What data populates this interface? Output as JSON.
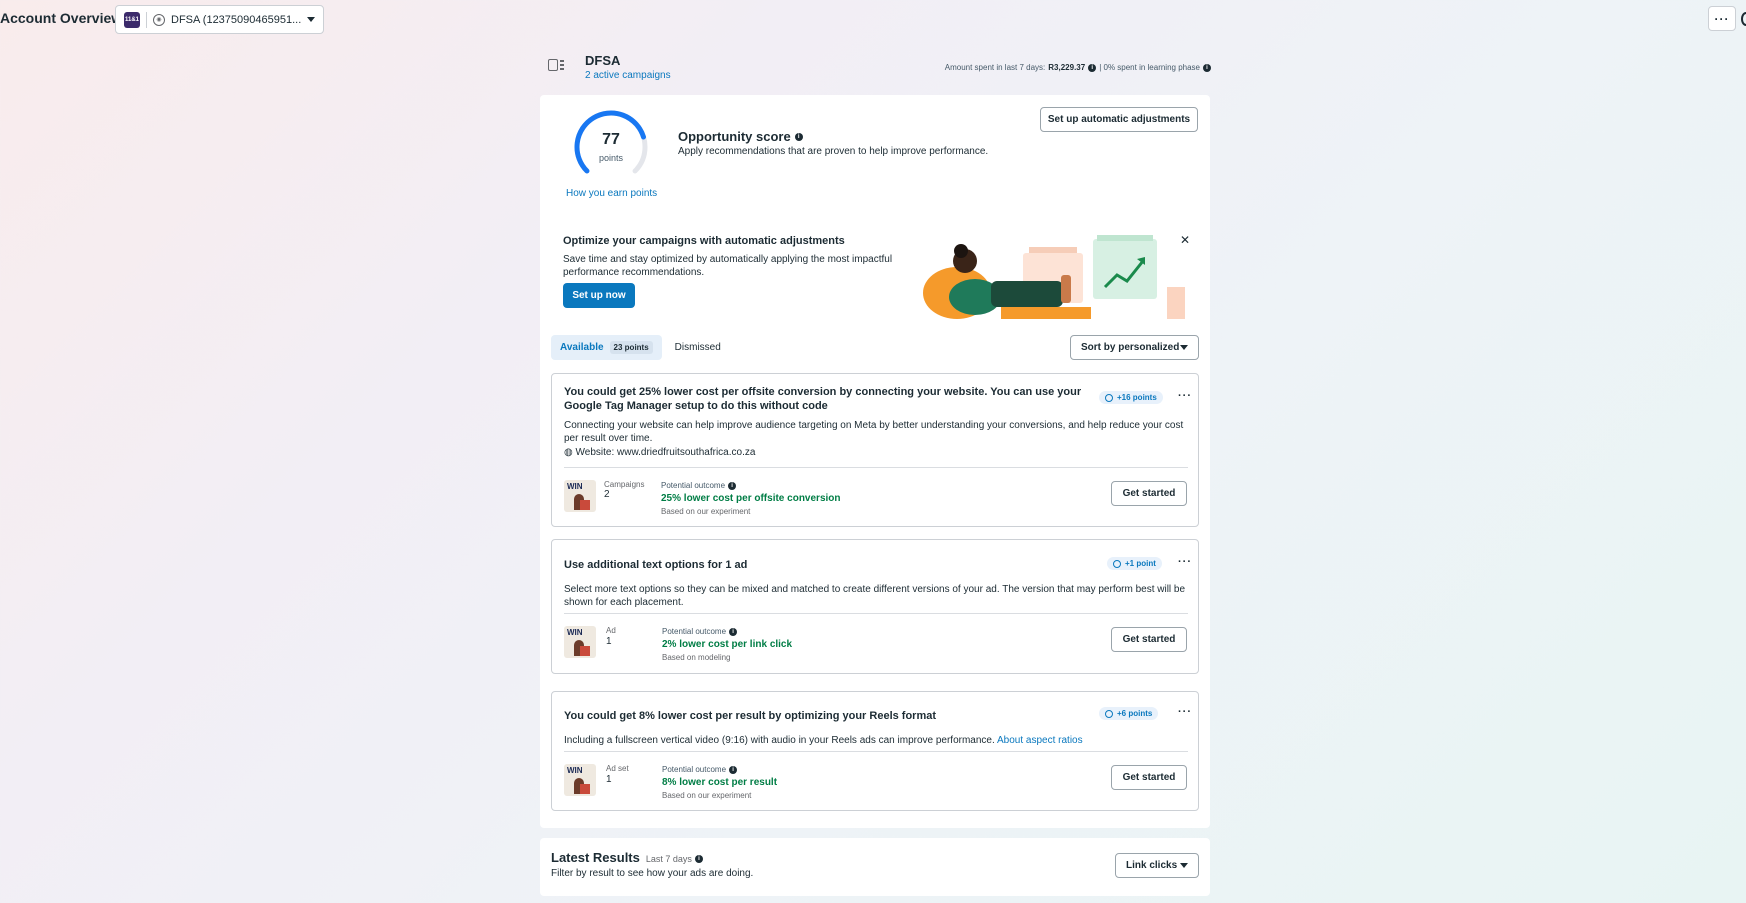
{
  "header": {
    "page_title": "Account Overview",
    "account_logo_text": "11&1",
    "account_label": "DFSA (12375090465951...",
    "more_label": "···"
  },
  "account": {
    "name": "DFSA",
    "campaigns_link": "2 active campaigns",
    "spend_prefix": "Amount spent in last 7 days:",
    "spend_value": "R3,229.37",
    "learning_text": "| 0% spent in learning phase"
  },
  "score": {
    "value": "77",
    "unit": "points",
    "fraction": 0.77,
    "earn_link": "How you earn points",
    "title": "Opportunity score",
    "description": "Apply recommendations that are proven to help improve performance.",
    "auto_button": "Set up automatic adjustments"
  },
  "banner": {
    "title": "Optimize your campaigns with automatic adjustments",
    "description": "Save time and stay optimized by automatically applying the most impactful performance recommendations.",
    "button": "Set up now",
    "close": "✕"
  },
  "tabs": {
    "available_label": "Available",
    "available_badge": "23 points",
    "dismissed_label": "Dismissed",
    "sort_label": "Sort by personalized"
  },
  "cards": [
    {
      "title": "You could get 25% lower cost per offsite conversion by connecting your website. You can use your Google Tag Manager setup to do this without code",
      "points": "+16 points",
      "description": "Connecting your website can help improve audience targeting on Meta by better understanding your conversions, and help reduce your cost per result over time.",
      "website": "Website: www.driedfruitsouthafrica.co.za",
      "meta_label": "Campaigns",
      "meta_value": "2",
      "outcome_label": "Potential outcome",
      "outcome_value": "25% lower cost per offsite conversion",
      "outcome_note": "Based on our experiment",
      "button": "Get started"
    },
    {
      "title": "Use additional text options for 1 ad",
      "points": "+1 point",
      "description": "Select more text options so they can be mixed and matched to create different versions of your ad. The version that may perform best will be shown for each placement.",
      "meta_label": "Ad",
      "meta_value": "1",
      "outcome_label": "Potential outcome",
      "outcome_value": "2% lower cost per link click",
      "outcome_note": "Based on modeling",
      "button": "Get started"
    },
    {
      "title": "You could get 8% lower cost per result by optimizing your Reels format",
      "points": "+6 points",
      "description": "Including a fullscreen vertical video (9:16) with audio in your Reels ads can improve performance.",
      "link": "About aspect ratios",
      "meta_label": "Ad set",
      "meta_value": "1",
      "outcome_label": "Potential outcome",
      "outcome_value": "8% lower cost per result",
      "outcome_note": "Based on our experiment",
      "button": "Get started"
    }
  ],
  "thumb_text": "WIN",
  "results": {
    "title": "Latest Results",
    "period": "Last 7 days",
    "description": "Filter by result to see how your ads are doing.",
    "filter": "Link clicks"
  },
  "colors": {
    "accent": "#0a78be",
    "positive": "#007d45",
    "ring": "#1877f2"
  }
}
